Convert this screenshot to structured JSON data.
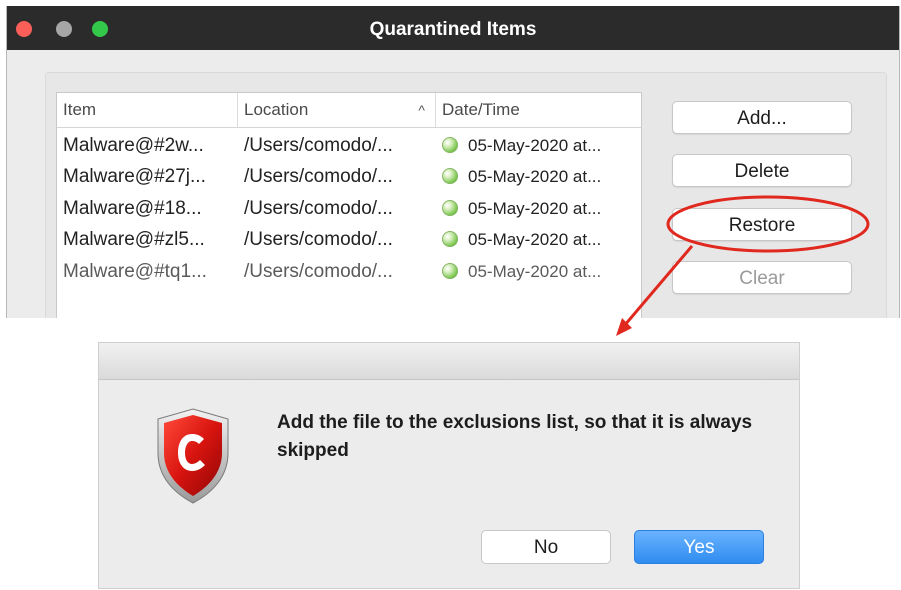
{
  "window": {
    "title": "Quarantined Items",
    "table": {
      "columns": [
        "Item",
        "Location",
        "Date/Time"
      ],
      "sort_indicator": "^",
      "rows": [
        {
          "item": "Malware@#2w...",
          "location": "/Users/comodo/...",
          "datetime": "05-May-2020 at..."
        },
        {
          "item": "Malware@#27j...",
          "location": "/Users/comodo/...",
          "datetime": "05-May-2020 at..."
        },
        {
          "item": "Malware@#18...",
          "location": "/Users/comodo/...",
          "datetime": "05-May-2020 at..."
        },
        {
          "item": "Malware@#zl5...",
          "location": "/Users/comodo/...",
          "datetime": "05-May-2020 at..."
        },
        {
          "item": "Malware@#tq1...",
          "location": "/Users/comodo/...",
          "datetime": "05-May-2020 at..."
        }
      ]
    },
    "buttons": {
      "add": "Add...",
      "delete": "Delete",
      "restore": "Restore",
      "clear": "Clear"
    }
  },
  "dialog": {
    "message": "Add the file to the exclusions list, so that it is always skipped",
    "buttons": {
      "no": "No",
      "yes": "Yes"
    },
    "icon": "comodo-shield-icon"
  },
  "colors": {
    "callout": "#e0281e",
    "accent_blue": "#2f8cf0",
    "titlebar": "#2b2b2b"
  }
}
